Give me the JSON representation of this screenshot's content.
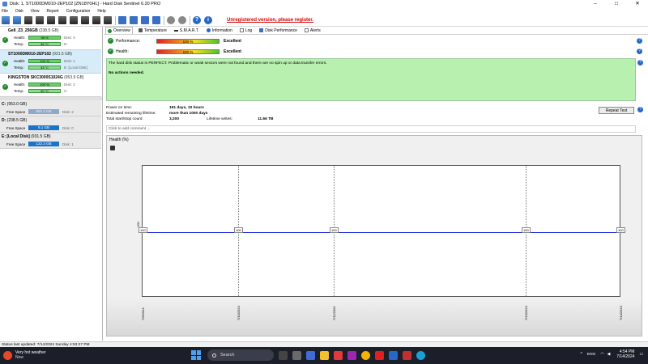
{
  "window": {
    "title": "Disk: 1, ST1000DM010-2EP102 [ZN18Y0HL]  -  Hard Disk Sentinel 6.20 PRO",
    "controls": [
      "–",
      "□",
      "✕"
    ]
  },
  "menu": [
    "File",
    "Disk",
    "View",
    "Report",
    "Configuration",
    "Help"
  ],
  "toolbar": {
    "unregistered": "Unregistered version, please register."
  },
  "disks": [
    {
      "name": "Gell_Z3_256GB",
      "size": "(238.5 GB)",
      "health": "98 %",
      "health_tail": "Disk: 0",
      "temp": "36 °C",
      "temp_tail": "D:",
      "health_label": "Health:",
      "temp_label": "Temp.:"
    },
    {
      "name": "ST1000DM010-2EP102",
      "size": "(931.5 GB)",
      "health": "100 %",
      "health_tail": "Disk: 1",
      "temp": "33 °C",
      "temp_tail": "E: [Local Disk]",
      "health_label": "Health:",
      "temp_label": "Temp.:"
    },
    {
      "name": "KINGSTON SKC3000S1024G",
      "size": "(953.9 GB)",
      "health": "100 %",
      "health_tail": "Disk: 2",
      "temp": "40 °C",
      "temp_tail": "C:",
      "health_label": "Health:",
      "temp_label": "Temp.:"
    }
  ],
  "partitions": [
    {
      "name": "C:",
      "size": "(953.0 GB)",
      "label": "Free Space",
      "free": "860.4 GB",
      "tail": "Disk: 2"
    },
    {
      "name": "D:",
      "size": "(238.5 GB)",
      "label": "Free Space",
      "free": "9.1 GB",
      "tail": "Disk: 0"
    },
    {
      "name": "E: [Local Disk]",
      "size": "(931.5 GB)",
      "label": "Free Space",
      "free": "122.3 GB",
      "tail": "Disk: 1"
    }
  ],
  "tabs": [
    "Overview",
    "Temperature",
    "S.M.A.R.T.",
    "Information",
    "Log",
    "Disk Performance",
    "Alerts"
  ],
  "overview": {
    "performance_label": "Performance:",
    "performance_value": "100 %",
    "performance_text": "Excellent",
    "health_label": "Health:",
    "health_value": "100 %",
    "health_text": "Excellent",
    "status_line1": "The hard disk status is PERFECT. Problematic or weak sectors were not found and there are no spin up or data transfer errors.",
    "status_line2": "No actions needed.",
    "power_on_label": "Power on time:",
    "power_on_value": "191 days, 10 hours",
    "lifetime_label": "Estimated remaining lifetime:",
    "lifetime_value": "more than 1000 days",
    "startstop_label": "Total start/stop count:",
    "startstop_value": "3,200",
    "writes_label": "Lifetime writes:",
    "writes_value": "11.66 TB",
    "repeat_button": "Repeat Test",
    "comment_placeholder": "Click to add comment ..."
  },
  "chart_data": {
    "type": "line",
    "title": "Health (%)",
    "x": [
      "7/9/2024",
      "7/10/2024",
      "7/11/2024",
      "7/13/2024",
      "7/14/2024"
    ],
    "series": [
      {
        "values": [
          100,
          100,
          100,
          100,
          100
        ]
      }
    ],
    "ylabel": "100",
    "grid": true
  },
  "statusbar": "Status last updated: 7/14/2024 Sunday 4:53:27 PM",
  "taskbar": {
    "weather_title": "Very hot weather",
    "weather_sub": "Now",
    "search": "Search",
    "lang": "ENG",
    "time": "4:54 PM",
    "date": "7/14/2024"
  },
  "colors": {
    "status_ok": "#b8f0b0",
    "chart_line": "#1d2bd8",
    "unregistered": "#d40000",
    "taskbar": "#1c1f2a"
  }
}
